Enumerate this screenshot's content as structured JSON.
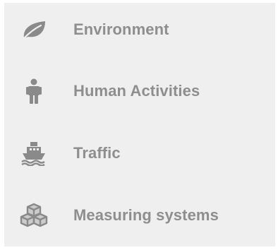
{
  "menu": {
    "items": [
      {
        "label": "Environment",
        "icon": "leaf-icon"
      },
      {
        "label": "Human Activities",
        "icon": "person-icon"
      },
      {
        "label": "Traffic",
        "icon": "ship-icon"
      },
      {
        "label": "Measuring systems",
        "icon": "cubes-icon"
      }
    ]
  },
  "colors": {
    "background": "#efefef",
    "text": "#8e8e8e",
    "icon": "#8a8a8a"
  }
}
